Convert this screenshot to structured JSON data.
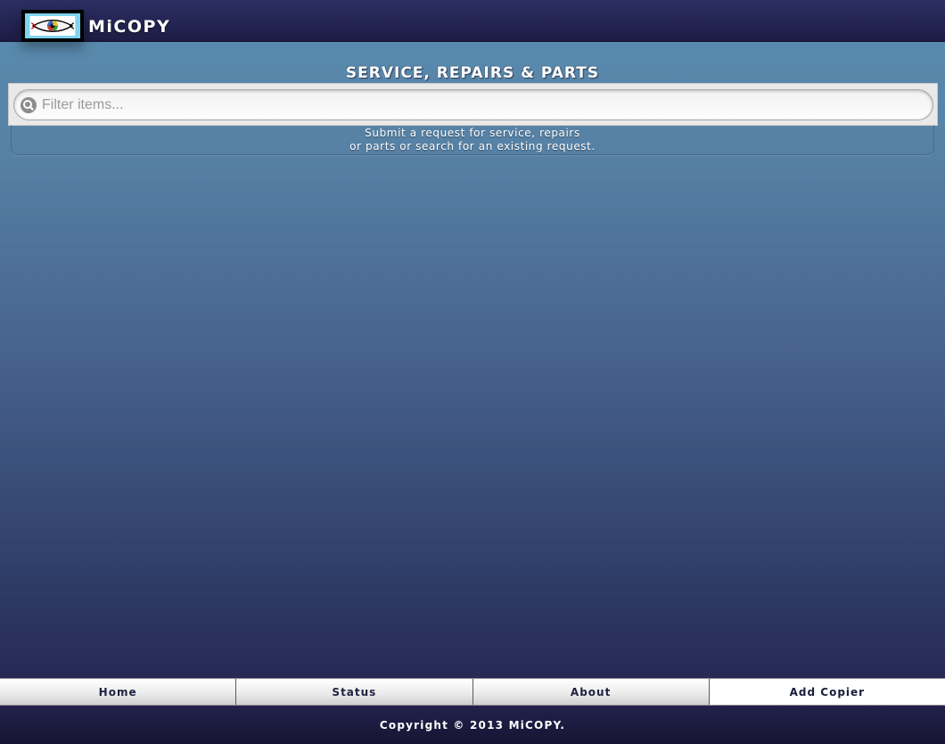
{
  "header": {
    "brand": "MiCOPY",
    "logo_icon": "eye-logo-icon"
  },
  "page": {
    "title": "SERVICE, REPAIRS & PARTS"
  },
  "filter": {
    "placeholder": "Filter items...",
    "value": "",
    "icon": "search-icon"
  },
  "info": {
    "line1": "Submit a request for service, repairs",
    "line2": "or parts or search for an existing request."
  },
  "navbar": {
    "tabs": [
      {
        "label": "Home",
        "active": false
      },
      {
        "label": "Status",
        "active": false
      },
      {
        "label": "About",
        "active": false
      },
      {
        "label": "Add Copier",
        "active": true
      }
    ]
  },
  "footer": {
    "copyright": "Copyright © 2013 MiCOPY."
  },
  "colors": {
    "header_bg": "#1d1c45",
    "background_top": "#5a8db0",
    "background_bottom": "#262a54",
    "logo_bg": "#7fd3ef",
    "nav_text": "#1f2340"
  }
}
